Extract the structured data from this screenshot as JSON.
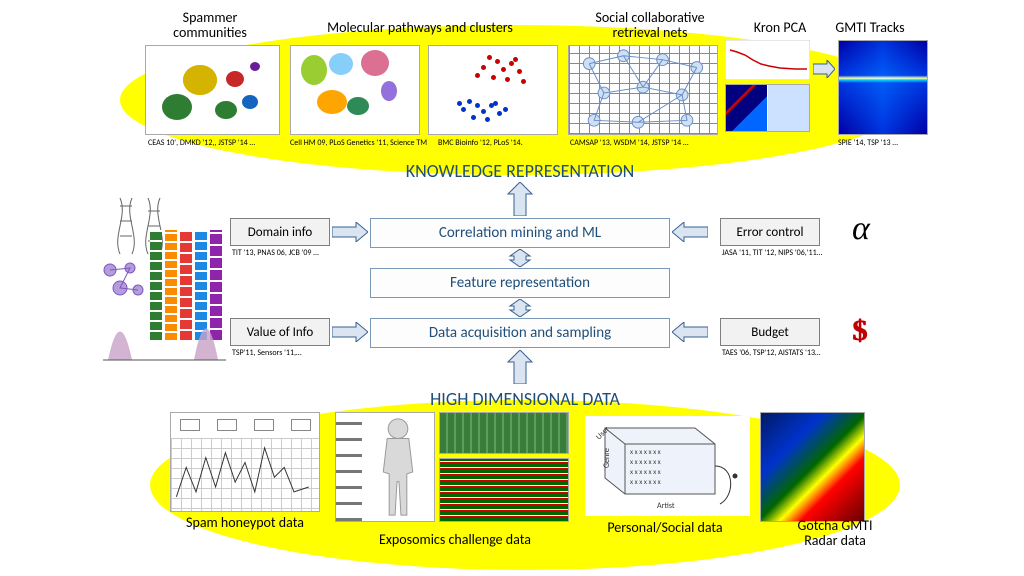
{
  "top": {
    "section_title": "KNOWLEDGE REPRESENTATION",
    "topics": {
      "spammer": "Spammer\ncommunities",
      "molecular": "Molecular pathways and clusters",
      "social": "Social collaborative\nretrieval nets",
      "kronpca": "Kron PCA",
      "gmti": "GMTI Tracks"
    },
    "cites": {
      "spammer": "CEAS 10', DMKD '12,, JSTSP '14 …",
      "molecular_a": "Cell HM 09, PLoS Genetics '11, Science TM",
      "molecular_b": "BMC  Bioinfo '12, PLoS '14.",
      "social": "CAMSAP '13, WSDM '14, JSTSP '14 …",
      "gmti": "SPIE '14, TSP '13 …"
    }
  },
  "center": {
    "box1": "Correlation mining and ML",
    "box2": "Feature representation",
    "box3": "Data acquisition and sampling",
    "side": {
      "domain": "Domain info",
      "value": "Value of Info",
      "error": "Error control",
      "budget": "Budget"
    },
    "side_cites": {
      "domain": "TIT '13,  PNAS 06, JCB '09 …",
      "value": "TSP'11,  Sensors '11,…",
      "error": "JASA '11,  TIT '12, NIPS '06,'11…",
      "budget": "TAES '06, TSP'12,  AISTATS '13…"
    },
    "symbols": {
      "alpha": "α",
      "dollar": "$"
    }
  },
  "bottom": {
    "section_title": "HIGH DIMENSIONAL DATA",
    "topics": {
      "honeypot": "Spam honeypot data",
      "exposomics": "Exposomics challenge data",
      "personal": "Personal/Social data",
      "gotcha": "Gotcha GMTI\nRadar data"
    }
  }
}
